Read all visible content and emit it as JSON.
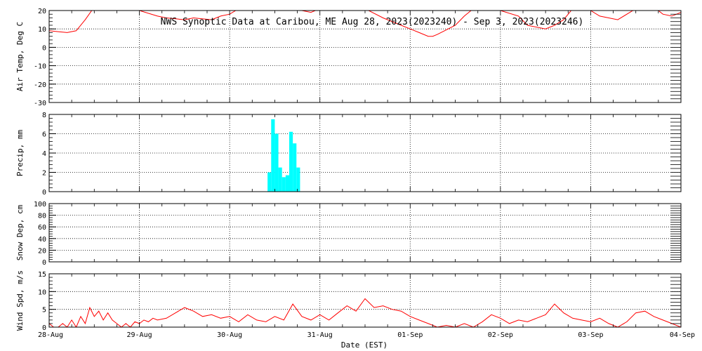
{
  "chart_data": {
    "type": "multi-panel timeseries",
    "title": "NWS Synoptic Data at Caribou, ME   Aug 28, 2023(2023240) - Sep  3, 2023(2023246)",
    "xlabel": "Date (EST)",
    "x_ticks": [
      "28-Aug",
      "29-Aug",
      "30-Aug",
      "31-Aug",
      "01-Sep",
      "02-Sep",
      "03-Sep",
      "04-Sep"
    ],
    "x_range_days": [
      0,
      7
    ],
    "grid": true,
    "panels": [
      {
        "id": "air_temp",
        "type": "line",
        "ylabel": "Air Temp, Deg C",
        "ylim": [
          -30,
          20
        ],
        "yticks": [
          20,
          10,
          0,
          -10,
          -20,
          -30
        ],
        "color": "#ff0000",
        "series": [
          {
            "x": [
              0,
              0.1,
              0.2,
              0.3,
              0.4,
              0.5,
              0.7,
              0.8,
              1.0,
              1.2,
              1.3,
              1.5,
              1.6,
              1.8,
              1.9,
              2.0,
              2.1,
              2.3,
              2.5,
              2.6,
              2.7,
              2.8,
              2.9,
              3.0,
              3.1,
              3.3,
              3.5,
              3.7,
              3.9,
              4.0,
              4.1,
              4.2,
              4.25,
              4.3,
              4.5,
              4.6,
              4.75,
              4.8,
              5.0,
              5.2,
              5.3,
              5.5,
              5.6,
              5.7,
              5.8,
              5.9,
              6.0,
              6.1,
              6.2,
              6.3,
              6.5,
              6.6,
              6.7,
              6.8,
              6.9,
              7.0
            ],
            "y": [
              9,
              8.5,
              8,
              9,
              15,
              22,
              25,
              24,
              20,
              17,
              16,
              15,
              16,
              15,
              17,
              18,
              21,
              22,
              22,
              21,
              22,
              20,
              19,
              21,
              23,
              24,
              21,
              16,
              12,
              10,
              8,
              6,
              6,
              7,
              12,
              17,
              23,
              25,
              20,
              17,
              12,
              10,
              12,
              15,
              21,
              24,
              20,
              17,
              16,
              15,
              21,
              24,
              22,
              18,
              17,
              19
            ]
          }
        ]
      },
      {
        "id": "precip",
        "type": "bar",
        "ylabel": "Precip, mm",
        "ylim": [
          0,
          8
        ],
        "yticks": [
          8,
          6,
          4,
          2,
          0
        ],
        "color": "#00ffff",
        "series": [
          {
            "x_start": [
              2.42,
              2.46,
              2.5,
              2.54,
              2.58,
              2.62,
              2.66,
              2.7,
              2.74,
              2.78
            ],
            "width": 0.04,
            "values": [
              2,
              7.5,
              6,
              2.5,
              1.5,
              1.7,
              6.2,
              5,
              2.5,
              0
            ]
          }
        ]
      },
      {
        "id": "snow_dep",
        "type": "line",
        "ylabel": "Snow Dep, cm",
        "ylim": [
          0,
          100
        ],
        "yticks": [
          100,
          80,
          60,
          40,
          20,
          0
        ],
        "color": "#ff0000",
        "series": [
          {
            "x": [],
            "y": []
          }
        ]
      },
      {
        "id": "wind_spd",
        "type": "line",
        "ylabel": "Wind Spd, m/s",
        "ylim": [
          0,
          15
        ],
        "yticks": [
          15,
          10,
          5,
          0
        ],
        "color": "#ff0000",
        "series": [
          {
            "x": [
              0,
              0.05,
              0.1,
              0.15,
              0.2,
              0.25,
              0.3,
              0.35,
              0.4,
              0.45,
              0.5,
              0.55,
              0.6,
              0.65,
              0.7,
              0.75,
              0.8,
              0.85,
              0.9,
              0.95,
              1.0,
              1.05,
              1.1,
              1.15,
              1.2,
              1.3,
              1.4,
              1.5,
              1.6,
              1.7,
              1.8,
              1.9,
              2.0,
              2.1,
              2.2,
              2.3,
              2.4,
              2.5,
              2.6,
              2.7,
              2.8,
              2.9,
              3.0,
              3.1,
              3.2,
              3.3,
              3.4,
              3.5,
              3.6,
              3.7,
              3.8,
              3.9,
              4.0,
              4.1,
              4.2,
              4.3,
              4.4,
              4.5,
              4.6,
              4.7,
              4.8,
              4.9,
              5.0,
              5.1,
              5.2,
              5.3,
              5.4,
              5.5,
              5.6,
              5.7,
              5.8,
              5.9,
              6.0,
              6.1,
              6.2,
              6.3,
              6.4,
              6.5,
              6.6,
              6.7,
              6.8,
              6.9,
              7.0
            ],
            "y": [
              1,
              0,
              0,
              1,
              0,
              2,
              0,
              3,
              1,
              5.5,
              3,
              4.5,
              2,
              4,
              2,
              1,
              0,
              1,
              0,
              1.5,
              1,
              2,
              1.5,
              2.5,
              2,
              2.5,
              4,
              5.5,
              4.5,
              3,
              3.5,
              2.5,
              3,
              1.5,
              3.5,
              2,
              1.5,
              3,
              2,
              6.5,
              3,
              2,
              3.5,
              2,
              4,
              6,
              4.5,
              8,
              5.5,
              6,
              5,
              4.5,
              3,
              2,
              1,
              0,
              0.5,
              0,
              1,
              0,
              1.5,
              3.5,
              2.5,
              1,
              2,
              1.5,
              2.5,
              3.5,
              6.5,
              4,
              2.5,
              2,
              1.5,
              2.5,
              1,
              0,
              1.5,
              4,
              4.5,
              3,
              2,
              1,
              0
            ]
          }
        ]
      }
    ]
  }
}
